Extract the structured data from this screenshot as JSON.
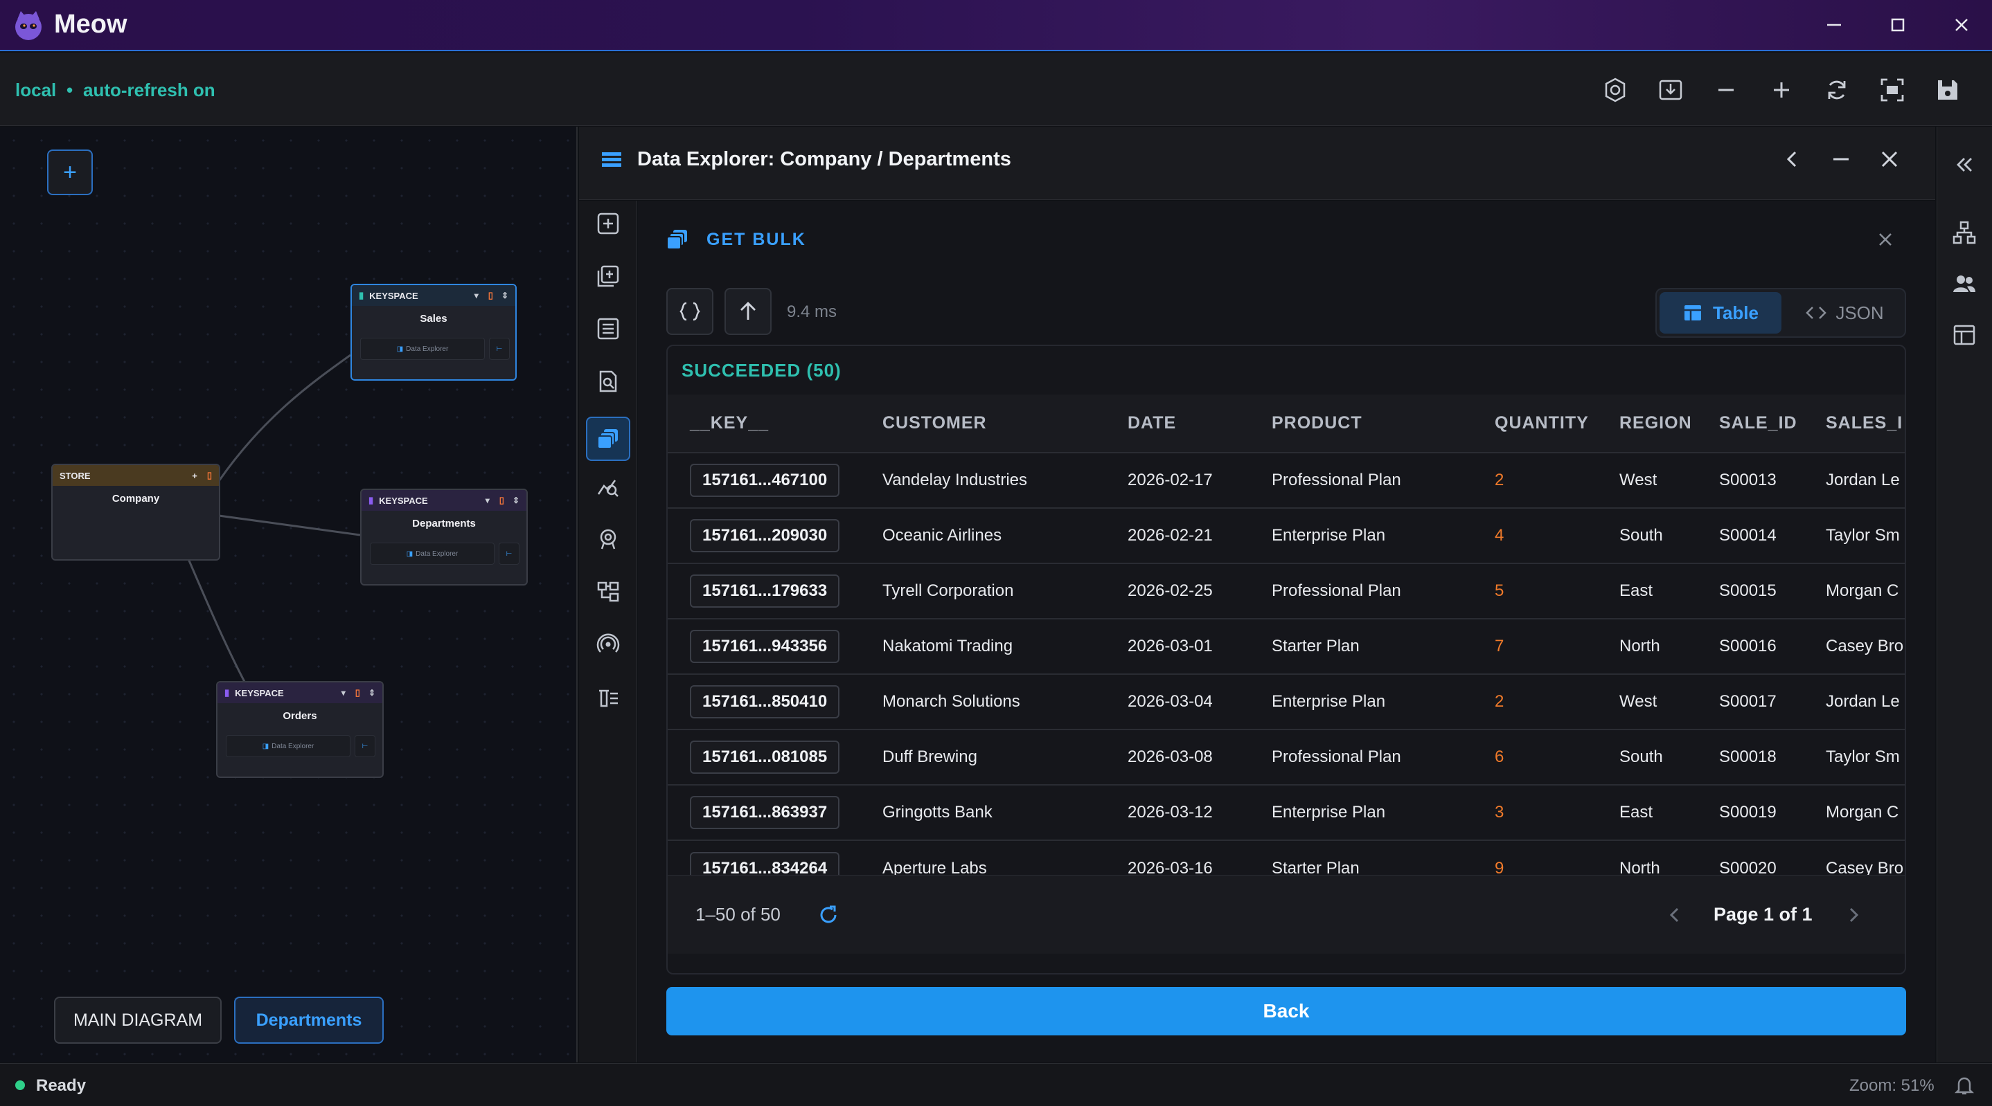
{
  "app": {
    "title": "Meow"
  },
  "connection": {
    "name": "local",
    "separator": "•",
    "refresh": "auto-refresh on"
  },
  "toolbar": {
    "icons": [
      "settings-gear-icon",
      "import-icon",
      "zoom-out-icon",
      "zoom-in-icon",
      "refresh-icon",
      "fit-screen-icon",
      "save-icon"
    ]
  },
  "diagram": {
    "nodes": [
      {
        "type": "KEYSPACE",
        "title": "Sales",
        "action": "Data Explorer",
        "selected": true
      },
      {
        "type": "STORE",
        "title": "Company"
      },
      {
        "type": "KEYSPACE",
        "title": "Departments",
        "action": "Data Explorer"
      },
      {
        "type": "KEYSPACE",
        "title": "Orders",
        "action": "Data Explorer"
      }
    ],
    "tabs": [
      "MAIN DIAGRAM",
      "Departments"
    ],
    "add_symbol": "+"
  },
  "panel": {
    "title": "Data Explorer: Company / Departments",
    "operation": "GET BULK",
    "timing": "9.4 ms",
    "view_toggle": {
      "table": "Table",
      "json": "JSON",
      "active": "Table"
    },
    "status": "SUCCEEDED (50)",
    "columns": [
      "__KEY__",
      "CUSTOMER",
      "DATE",
      "PRODUCT",
      "QUANTITY",
      "REGION",
      "SALE_ID",
      "SALES_I"
    ],
    "rows": [
      {
        "key": "157161...467100",
        "customer": "Vandelay Industries",
        "date": "2026-02-17",
        "product": "Professional Plan",
        "quantity": "2",
        "region": "West",
        "sale_id": "S00013",
        "sales": "Jordan Le"
      },
      {
        "key": "157161...209030",
        "customer": "Oceanic Airlines",
        "date": "2026-02-21",
        "product": "Enterprise Plan",
        "quantity": "4",
        "region": "South",
        "sale_id": "S00014",
        "sales": "Taylor Sm"
      },
      {
        "key": "157161...179633",
        "customer": "Tyrell Corporation",
        "date": "2026-02-25",
        "product": "Professional Plan",
        "quantity": "5",
        "region": "East",
        "sale_id": "S00015",
        "sales": "Morgan C"
      },
      {
        "key": "157161...943356",
        "customer": "Nakatomi Trading",
        "date": "2026-03-01",
        "product": "Starter Plan",
        "quantity": "7",
        "region": "North",
        "sale_id": "S00016",
        "sales": "Casey Bro"
      },
      {
        "key": "157161...850410",
        "customer": "Monarch Solutions",
        "date": "2026-03-04",
        "product": "Enterprise Plan",
        "quantity": "2",
        "region": "West",
        "sale_id": "S00017",
        "sales": "Jordan Le"
      },
      {
        "key": "157161...081085",
        "customer": "Duff Brewing",
        "date": "2026-03-08",
        "product": "Professional Plan",
        "quantity": "6",
        "region": "South",
        "sale_id": "S00018",
        "sales": "Taylor Sm"
      },
      {
        "key": "157161...863937",
        "customer": "Gringotts Bank",
        "date": "2026-03-12",
        "product": "Enterprise Plan",
        "quantity": "3",
        "region": "East",
        "sale_id": "S00019",
        "sales": "Morgan C"
      },
      {
        "key": "157161...834264",
        "customer": "Aperture Labs",
        "date": "2026-03-16",
        "product": "Starter Plan",
        "quantity": "9",
        "region": "North",
        "sale_id": "S00020",
        "sales": "Casey Bro"
      }
    ],
    "range": "1–50 of 50",
    "page": "Page 1 of 1",
    "back": "Back"
  },
  "status": {
    "state": "Ready",
    "zoom": "Zoom: 51%"
  },
  "colors": {
    "accent": "#1e94ee",
    "success": "#2fc0b0",
    "quantity": "#f07a2a"
  }
}
